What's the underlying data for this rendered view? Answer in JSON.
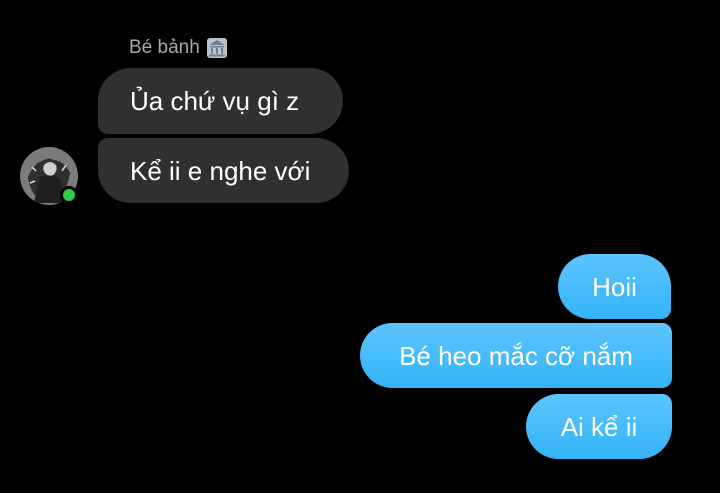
{
  "conversation": {
    "sender_name": "Bé bảnh",
    "sender_icon": "bank-emoji-icon",
    "online_status_color": "#31cc46",
    "incoming_bubble_color": "#303030",
    "outgoing_bubble_color": "#3db8fb",
    "incoming_messages": [
      {
        "text": "Ủa chứ vụ gì z"
      },
      {
        "text": "Kể ii e nghe với"
      }
    ],
    "outgoing_messages": [
      {
        "text": "Hoii"
      },
      {
        "text": "Bé heo mắc cỡ nắm"
      },
      {
        "text": "Ai kể ii"
      }
    ]
  }
}
